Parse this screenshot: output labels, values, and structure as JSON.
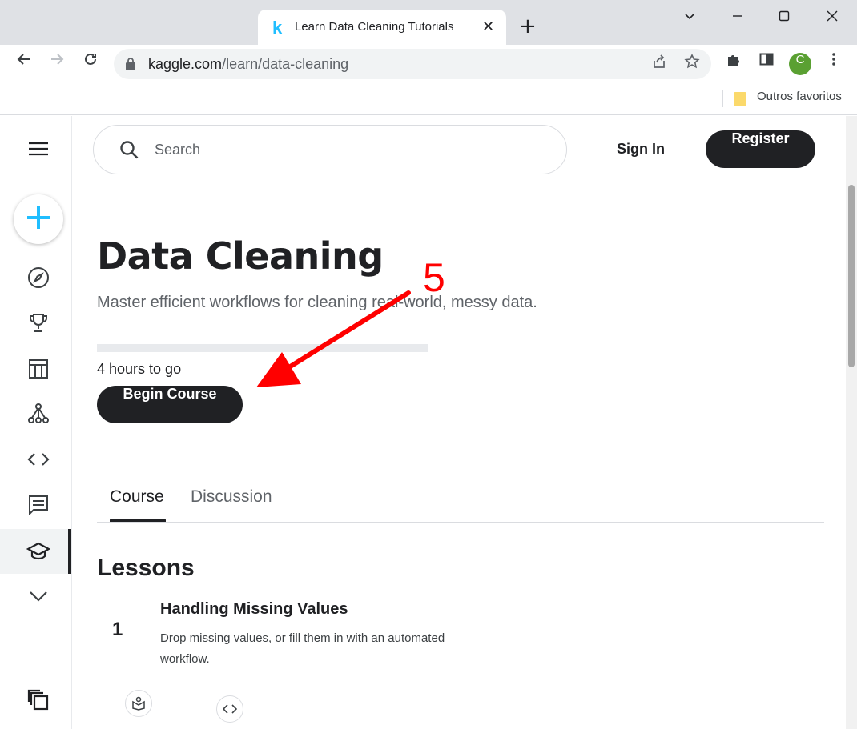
{
  "browser": {
    "tab_title": "Learn Data Cleaning Tutorials",
    "tab_favicon": "k",
    "tab_close": "✕",
    "new_tab": "+",
    "url_host": "kaggle.com",
    "url_path": "/learn/data-cleaning",
    "profile_initial": "C",
    "bookmark_folder": "Outros favoritos"
  },
  "header": {
    "search_placeholder": "Search",
    "signin_label": "Sign In",
    "register_label": "Register"
  },
  "course": {
    "title": "Data Cleaning",
    "subtitle": "Master efficient workflows for cleaning real-world, messy data.",
    "progress_fraction": 0,
    "time_left": "4 hours to go",
    "begin_label": "Begin Course"
  },
  "tabs": [
    {
      "label": "Course",
      "active": true
    },
    {
      "label": "Discussion",
      "active": false
    }
  ],
  "lessons": {
    "heading": "Lessons",
    "items": [
      {
        "number": "1",
        "title": "Handling Missing Values",
        "description": "Drop missing values, or fill them in with an automated workflow."
      }
    ]
  },
  "annotation": {
    "step_number": "5",
    "color": "#ff0000"
  },
  "colors": {
    "kaggle_blue": "#20beff",
    "dark_button": "#202124"
  }
}
